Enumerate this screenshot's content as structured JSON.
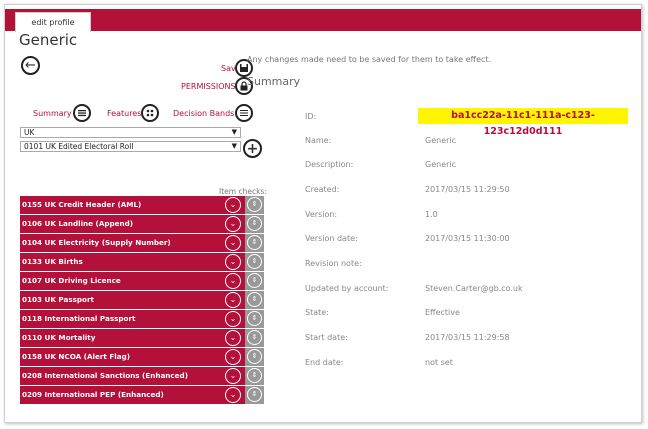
{
  "tab_label": "edit profile",
  "page_title": "Generic",
  "save_label": "Save",
  "permissions_label": "PERMISSIONS",
  "note": "Any changes made need to be saved for them to take effect.",
  "summary_heading": "Summary",
  "nav": {
    "summary": "Summary",
    "features": "Features",
    "decision_bands": "Decision Bands"
  },
  "selects": {
    "country": "UK",
    "dataset": "0101 UK Edited Electoral Roll"
  },
  "item_checks_label": "Item checks:",
  "items": [
    "0155 UK Credit Header (AML)",
    "0106 UK Landline (Append)",
    "0104 UK Electricity (Supply Number)",
    "0133 UK Births",
    "0107 UK Driving Licence",
    "0103 UK Passport",
    "0118 International Passport",
    "0110 UK Mortality",
    "0158 UK NCOA (Alert Flag)",
    "0208 International Sanctions (Enhanced)",
    "0209 International PEP (Enhanced)"
  ],
  "details": [
    {
      "label": "ID:",
      "value": "ba1cc22a-11c1-111a-c123-123c12d0d111"
    },
    {
      "label": "Name:",
      "value": "Generic"
    },
    {
      "label": "Description:",
      "value": "Generic"
    },
    {
      "label": "Created:",
      "value": "2017/03/15 11:29:50"
    },
    {
      "label": "Version:",
      "value": "1.0"
    },
    {
      "label": "Version date:",
      "value": "2017/03/15 11:30:00"
    },
    {
      "label": "Revision note:",
      "value": ""
    },
    {
      "label": "Updated by account:",
      "value": "Steven.Carter@gb.co.uk"
    },
    {
      "label": "State:",
      "value": "Effective"
    },
    {
      "label": "Start date:",
      "value": "2017/03/15 11:29:58"
    },
    {
      "label": "End date:",
      "value": "not set"
    }
  ],
  "colors": {
    "brand": "#b3103a",
    "highlight": "#fff500",
    "grey_button": "#999999"
  }
}
